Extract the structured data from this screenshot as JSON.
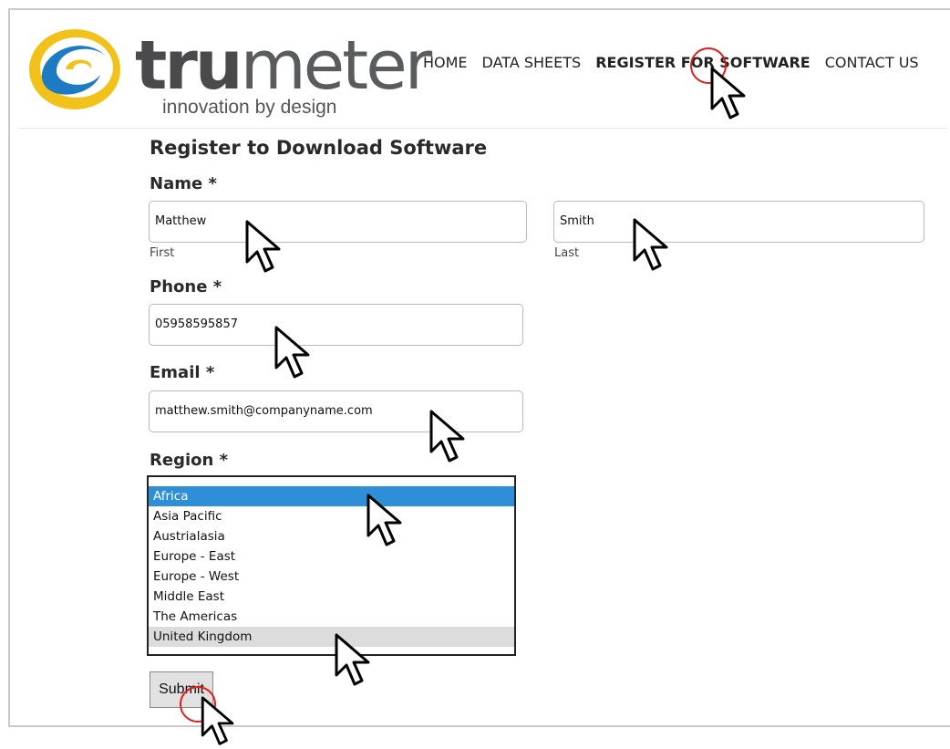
{
  "brand": {
    "logo_text_tru": "tru",
    "logo_text_meter": "meter",
    "tagline": "innovation by design",
    "colors": {
      "yellow": "#f2c21a",
      "blue": "#1d7bc4",
      "grey": "#555658"
    }
  },
  "nav": {
    "items": [
      {
        "label": "HOME",
        "active": false
      },
      {
        "label": "DATA SHEETS",
        "active": false
      },
      {
        "label": "REGISTER FOR SOFTWARE",
        "active": true
      },
      {
        "label": "CONTACT US",
        "active": false
      }
    ]
  },
  "form": {
    "title": "Register to Download Software",
    "name_label": "Name",
    "required_mark": "*",
    "first_value": "Matthew",
    "first_sublabel": "First",
    "last_value": "Smith",
    "last_sublabel": "Last",
    "phone_label": "Phone",
    "phone_value": "05958595857",
    "email_label": "Email",
    "email_value": "matthew.smith@companyname.com",
    "region_label": "Region",
    "region_options": [
      "Africa",
      "Asia Pacific",
      "Austrialasia",
      "Europe - East",
      "Europe - West",
      "Middle East",
      "The Americas",
      "United Kingdom"
    ],
    "region_selected": "Africa",
    "region_hovered": "United Kingdom",
    "submit_label": "Submit"
  },
  "annotations": {
    "cursor_icon": "arrow-cursor-icon",
    "click_marker_color": "#e21b1b"
  }
}
